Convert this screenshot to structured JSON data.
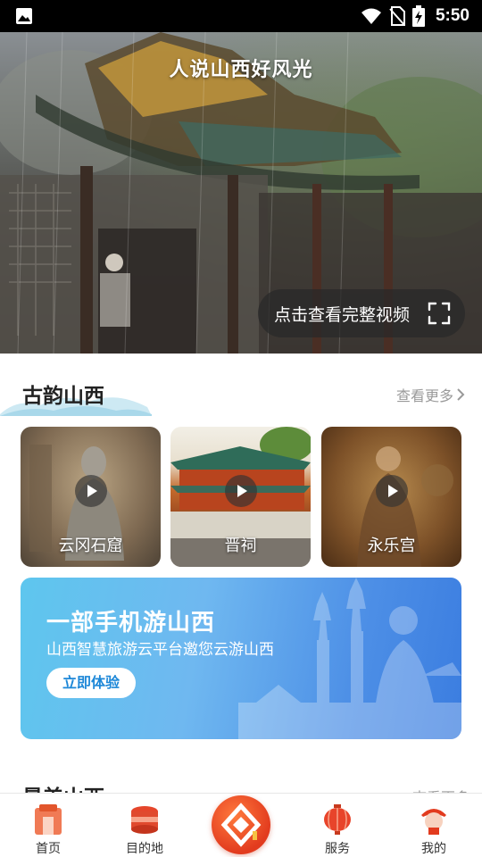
{
  "status_bar": {
    "time": "5:50"
  },
  "hero": {
    "title": "人说山西好风光",
    "video_button_label": "点击查看完整视频"
  },
  "section_gu": {
    "title": "古韵山西",
    "see_more": "查看更多"
  },
  "cards": [
    {
      "label": "云冈石窟"
    },
    {
      "label": "晋祠"
    },
    {
      "label": "永乐宫"
    }
  ],
  "promo": {
    "title": "一部手机游山西",
    "subtitle": "山西智慧旅游云平台邀您云游山西",
    "button_label": "立即体验"
  },
  "section_next": {
    "title": "景美山西",
    "see_more": "查看更多"
  },
  "tabs": [
    {
      "label": "首页"
    },
    {
      "label": "目的地"
    },
    {
      "label": "服务"
    },
    {
      "label": "我的"
    }
  ],
  "colors": {
    "accent": "#e23b1e",
    "promo_blue": "#4d8fe6",
    "muted_text": "#9a9a9a"
  }
}
